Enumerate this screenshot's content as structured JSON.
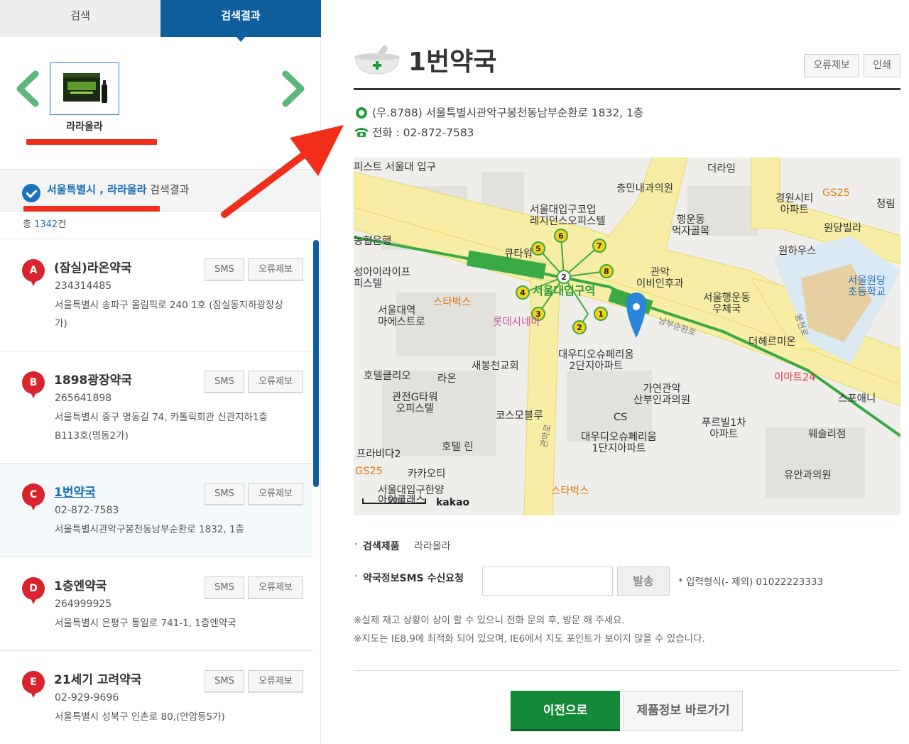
{
  "tabs": {
    "search": "검색",
    "results": "검색결과"
  },
  "product": {
    "name": "라라올라"
  },
  "result_header": {
    "region": "서울특별시",
    "separator": " , ",
    "keyword": "라라올라",
    "suffix": " 검색결과"
  },
  "total": {
    "prefix": "총 ",
    "count": "1342",
    "suffix": "건"
  },
  "buttons": {
    "sms": "SMS",
    "report": "오류제보",
    "print": "인쇄",
    "send": "발송",
    "prev": "이전으로",
    "goto_product": "제품정보 바로가기"
  },
  "pharmacies": [
    {
      "marker": "A",
      "name": "(잠실)라온약국",
      "phone": "234314485",
      "address": "서울특별시 송파구 올림픽로 240 1호 (잠실동지하광장상가)"
    },
    {
      "marker": "B",
      "name": "1898광장약국",
      "phone": "265641898",
      "address": "서울특별시 중구 명동길 74, 카톨릭회관 신관지하1층 B113호(명동2가)"
    },
    {
      "marker": "C",
      "name": "1번약국",
      "phone": "02-872-7583",
      "address": "서울특별시관악구봉천동남부순환로 1832, 1층"
    },
    {
      "marker": "D",
      "name": "1층엔약국",
      "phone": "264999925",
      "address": "서울특별시 은평구 통일로 741-1, 1층엔약국"
    },
    {
      "marker": "E",
      "name": "21세기 고려약국",
      "phone": "02-929-9696",
      "address": "서울특별시 성북구 인촌로 80,(안암동5가)"
    }
  ],
  "detail": {
    "title": "1번약국",
    "address": "(우.8788) 서울특별시관악구봉천동남부순환로 1832, 1층",
    "phone": "전화 : 02-872-7583",
    "product_label": "검색제품",
    "product_value": "라라올라",
    "sms_label": "약국정보SMS 수신요청",
    "sms_hint": "* 입력형식(- 제외) 01022223333",
    "notice1": "※실제 재고 상황이 상이 할 수 있으니 전화 문의 후, 방문 해 주세요.",
    "notice2": "※지도는 IE8,9에 최적화 되어 있으며, IE6에서 지도 포인트가 보이지 않을 수 있습니다."
  },
  "map": {
    "attribution": "kakao",
    "scale": "50m",
    "station": "서울대입구역",
    "exits": [
      "1",
      "2",
      "3",
      "4",
      "5",
      "6",
      "7",
      "8",
      "2"
    ],
    "labels": {
      "l1": "피스트 서울대\n입구",
      "l2": "농협은행",
      "l3": "성아이라이프\n피스텔",
      "l4": "서울대역\n마에스트로",
      "l5": "스타벅스",
      "l6": "롯데시네마",
      "l7": "큐타워",
      "l8": "서울대입구코업\n레지던스오피스텔",
      "l9": "충민내과의원",
      "l10": "더라임",
      "l11": "경원시티\n아파트",
      "l12": "GS25",
      "l13": "청림",
      "l14": "원당빌라",
      "l15": "원하우스",
      "l16": "행운동\n먹자골목",
      "l17": "관악\n이비인후과",
      "l18": "서울행운동\n우체국",
      "l19": "서울원당\n초등학교",
      "l20": "더헤르미온",
      "l21": "이마트24",
      "l22": "스포애니",
      "l23": "대우디오슈페리움\n2단지아파트",
      "l24": "새봉천교회",
      "l25": "호텔클리오",
      "l26": "라온",
      "l27": "관전G타워\n오피스텔",
      "l28": "코스모블루",
      "l29": "가연관악\n산부인과의원",
      "l30": "CS",
      "l31": "푸르빌1차\n아파트",
      "l32": "웨슬리점",
      "l33": "대우디오슈페리움\n1단지아파트",
      "l34": "호텔 린",
      "l35": "프라비다2",
      "l36": "GS25",
      "l37": "카카오티",
      "l38": "서울대입구한양\n아이클래스",
      "l39": "스타벅스",
      "l40": "유안과의원",
      "l41": "남부순환로",
      "l42": "관악로",
      "l43": "봉천로"
    }
  },
  "colors": {
    "brand_blue": "#0f5f9e",
    "marker_red": "#d9232d",
    "primary_green": "#148a37",
    "annotation_red": "#f02e1a"
  },
  "icons": [
    "chevron-left-icon",
    "chevron-right-icon",
    "check-circle-icon",
    "location-icon",
    "phone-icon",
    "mortar-pestle-icon",
    "map-pin-icon"
  ]
}
